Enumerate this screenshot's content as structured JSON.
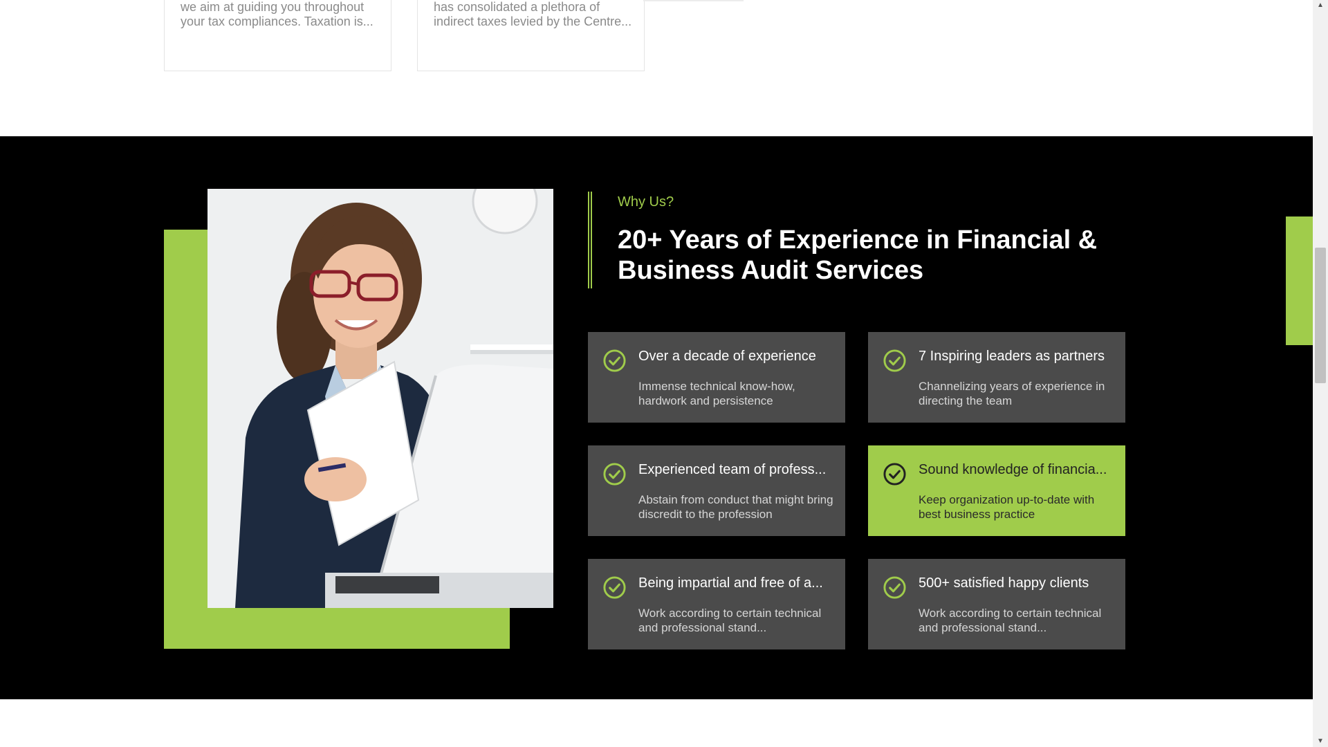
{
  "top_cards": [
    {
      "text": "we aim at guiding you throughout your tax compliances. Taxation is..."
    },
    {
      "text": "has consolidated a plethora of indirect taxes levied by the Centre..."
    }
  ],
  "why_us": {
    "eyebrow": "Why Us?",
    "headline": "20+ Years of Experience in Financial & Business Audit Services",
    "features": [
      {
        "title": "Over a decade of experience",
        "desc": "Immense technical know-how, hardwork and persistence",
        "icon": "check-circle-icon",
        "active": false
      },
      {
        "title": "7 Inspiring leaders as partners",
        "desc": "Channelizing years of experience in directing the team",
        "icon": "check-circle-icon",
        "active": false
      },
      {
        "title": "Experienced team of profess...",
        "desc": "Abstain from conduct that might bring discredit to the profession",
        "icon": "check-circle-icon",
        "active": false
      },
      {
        "title": "Sound knowledge of financia...",
        "desc": "Keep organization up-to-date with best business practice",
        "icon": "check-circle-icon",
        "active": true
      },
      {
        "title": "Being impartial and free of a...",
        "desc": "Work according to certain technical and professional stand...",
        "icon": "check-circle-icon",
        "active": false
      },
      {
        "title": "500+ satisfied happy clients",
        "desc": "Work according to certain technical and professional stand...",
        "icon": "check-circle-icon",
        "active": false
      }
    ]
  },
  "colors": {
    "accent": "#a0cc4b",
    "section_bg": "#000000",
    "card_bg": "#4b4b4b"
  },
  "scrollbar": {
    "up_icon": "arrow-up-icon",
    "down_icon": "arrow-down-icon"
  }
}
